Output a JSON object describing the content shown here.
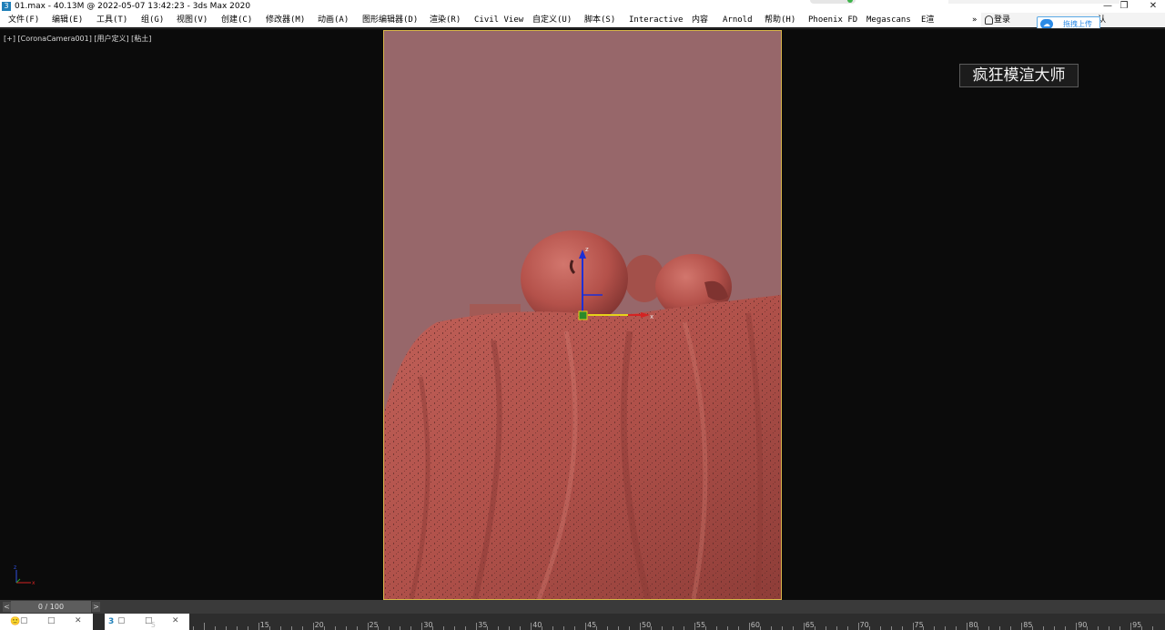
{
  "titlebar": {
    "app_icon": "3",
    "title": "01.max - 40.13M @ 2022-05-07 13:42:23 - 3ds Max 2020",
    "minimize_glyph": "—",
    "restore_glyph": "❐",
    "close_glyph": "✕"
  },
  "menu": {
    "items": [
      "文件(F)",
      "编辑(E)",
      "工具(T)",
      "组(G)",
      "视图(V)",
      "创建(C)",
      "修改器(M)",
      "动画(A)",
      "图形编辑器(D)",
      "渲染(R)",
      "Civil View",
      "自定义(U)",
      "脚本(S)",
      "Interactive",
      "内容",
      "Arnold",
      "帮助(H)",
      "Phoenix FD",
      "Megascans",
      "E渲"
    ],
    "more_glyph": "»",
    "login_label": "登录",
    "trailing_text": "认",
    "upload_label": "拖拽上传"
  },
  "viewport": {
    "label": "[+] [CoronaCamera001] [用户定义] [粘土]",
    "watermark": "疯狂模渲大师",
    "axes": {
      "z": "z",
      "x": "x"
    },
    "gizmo": {
      "z_label": "z",
      "x_label": "x"
    }
  },
  "timeslider": {
    "frame_display": "0 / 100",
    "current_frame": 0,
    "total_frames": 100,
    "prev_glyph": "<",
    "next_glyph": ">"
  },
  "taskbar": {
    "tabs": [
      {
        "icon": "🙂",
        "app": "3"
      },
      {
        "icon": "3",
        "app": ""
      }
    ]
  },
  "ruler": {
    "labels": [
      "5",
      "15",
      "20",
      "25",
      "30",
      "35",
      "40",
      "45",
      "50",
      "55",
      "60",
      "65",
      "70",
      "75",
      "80",
      "85",
      "90",
      "95",
      "100"
    ]
  },
  "colors": {
    "clay": "#b5524b",
    "background_wall": "#97676a",
    "safe_frame": "#d9b64a",
    "viewport_bg": "#0b0b0b",
    "gizmo_z": "#1d2fd6",
    "gizmo_x": "#d42323",
    "gizmo_y": "#e6d21a"
  }
}
